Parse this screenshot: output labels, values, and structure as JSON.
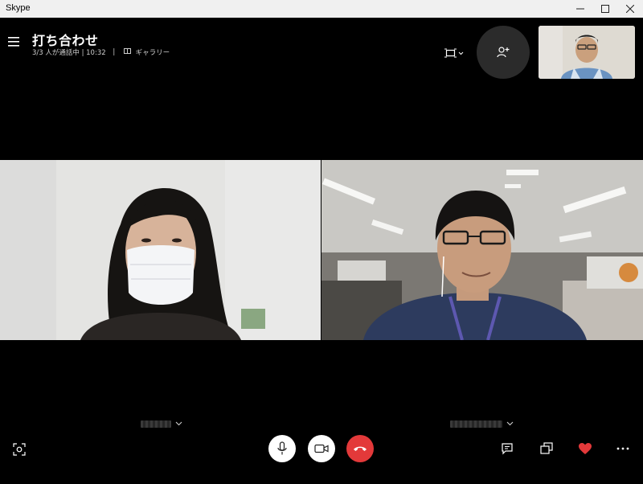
{
  "window": {
    "title": "Skype"
  },
  "call": {
    "title": "打ち合わせ",
    "participants": "3/3 人が通話中 | 10:32",
    "separator": "|",
    "view_mode": "ギャラリー"
  },
  "colors": {
    "end_call": "#e3393a",
    "heart": "#e3393a",
    "background": "#000000"
  },
  "icons": {
    "menu": "hamburger-icon",
    "layout": "layout-icon",
    "add_person": "add-person-icon",
    "screenshot": "screenshot-icon",
    "mic": "microphone-icon",
    "video": "video-camera-icon",
    "end_call": "end-call-icon",
    "chat": "chat-icon",
    "share": "share-screen-icon",
    "reaction": "heart-icon",
    "more": "more-icon"
  }
}
